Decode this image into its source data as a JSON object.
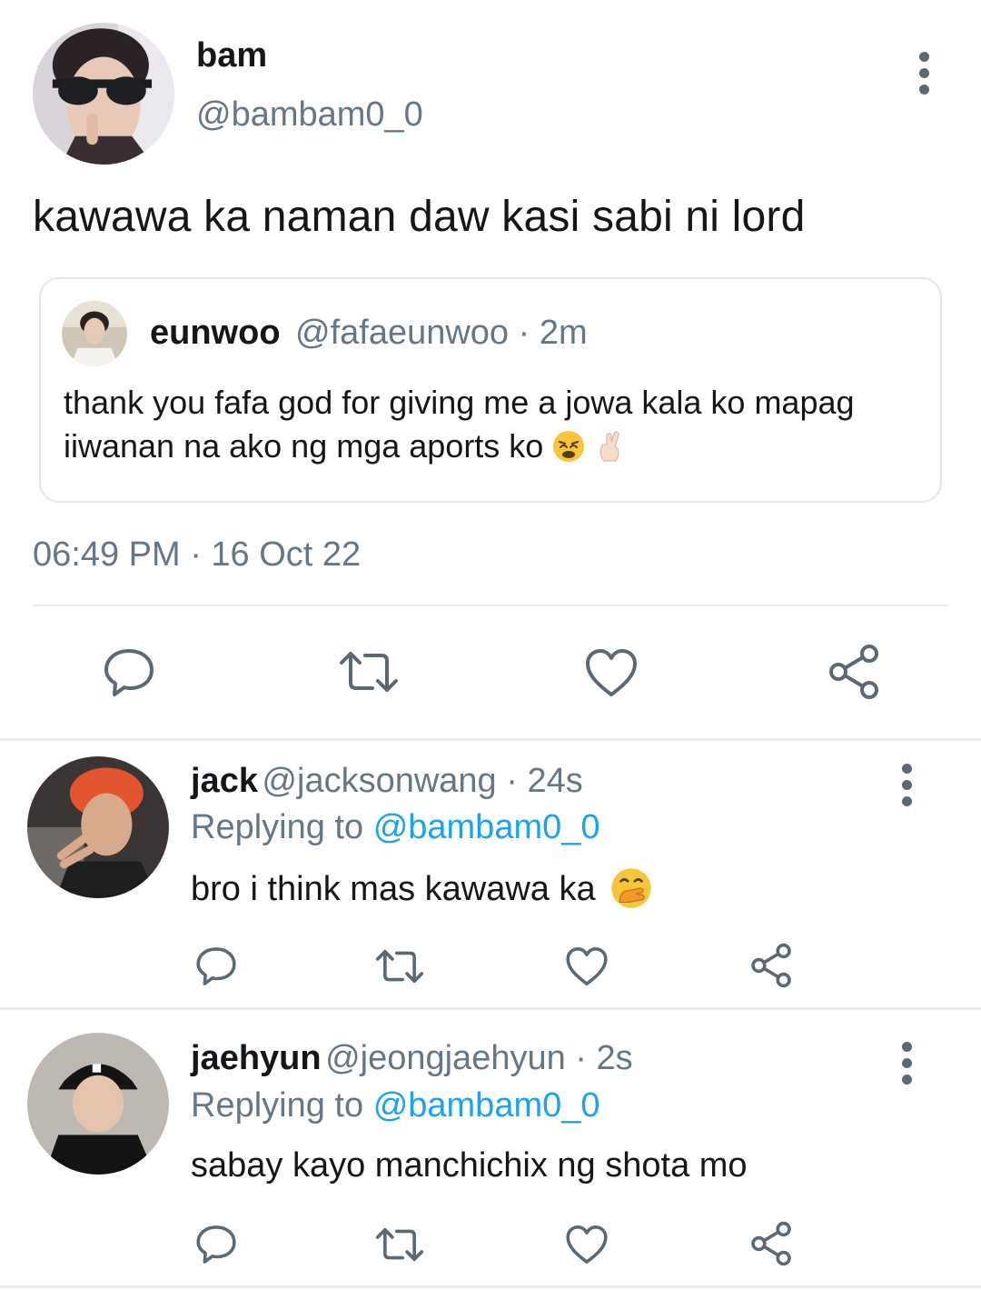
{
  "main_tweet": {
    "name": "bam",
    "handle": "@bambam0_0",
    "text": "kawawa ka naman daw kasi sabi ni lord",
    "timestamp": "06:49 PM · 16 Oct 22",
    "more_icon": "more-vertical-icon"
  },
  "quoted_tweet": {
    "name": "eunwoo",
    "meta": "@fafaeunwoo · 2m",
    "text": "thank you fafa god for giving me a jowa kala ko mapag iiwanan na ako ng mga aports ko",
    "emojis": [
      "weary-face-emoji",
      "crossed-fingers-emoji"
    ]
  },
  "actions": {
    "reply_icon": "reply-icon",
    "retweet_icon": "retweet-icon",
    "like_icon": "heart-icon",
    "share_icon": "share-icon"
  },
  "replies": [
    {
      "name": "jack",
      "meta": "@jacksonwang · 24s",
      "replying_label": "Replying to",
      "replying_to": "@bambam0_0",
      "text": "bro i think mas kawawa ka",
      "emoji": "hand-over-mouth-emoji"
    },
    {
      "name": "jaehyun",
      "meta": "@jeongjaehyun · 2s",
      "replying_label": "Replying to",
      "replying_to": "@bambam0_0",
      "text": "sabay kayo manchichix ng shota mo"
    }
  ],
  "colors": {
    "text": "#14171a",
    "secondary": "#657786",
    "link": "#1da1f2",
    "divider": "#e6ecf0",
    "icon": "#5b6975"
  }
}
